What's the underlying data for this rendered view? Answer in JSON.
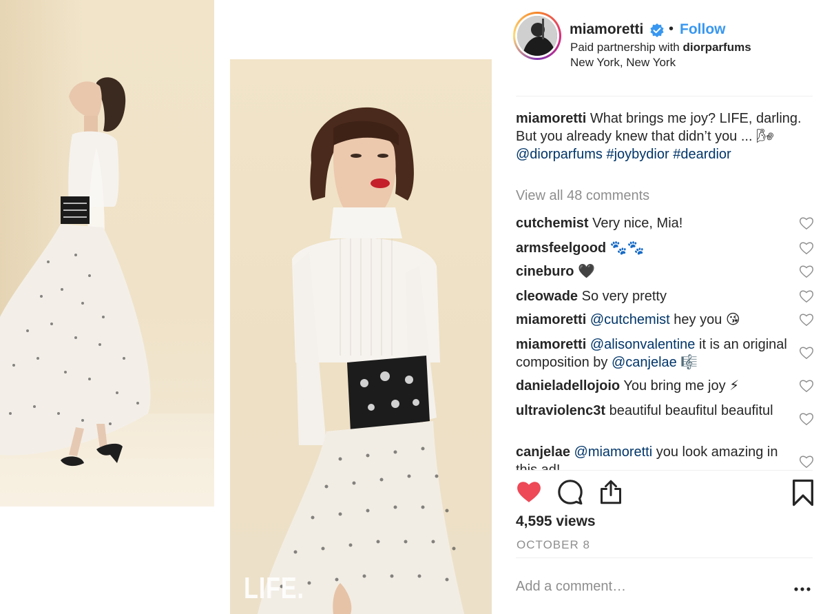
{
  "media": {
    "overlay_text": "LIFE."
  },
  "header": {
    "username": "miamoretti",
    "separator": "•",
    "follow_label": "Follow",
    "partnership_prefix": "Paid partnership with ",
    "partner": "diorparfums",
    "location": "New York, New York"
  },
  "caption": {
    "username": "miamoretti",
    "text": "What brings me joy? LIFE, darling. But you already knew that didn’t you ... ",
    "emoji": "🌬",
    "mention": "@diorparfums",
    "hashtag1": "#joybydior",
    "hashtag2": "#deardior"
  },
  "view_all_comments": "View all 48 comments",
  "comments": [
    {
      "user": "cutchemist",
      "text": "Very nice, Mia!"
    },
    {
      "user": "armsfeelgood",
      "text": "🐾🐾"
    },
    {
      "user": "cineburo",
      "text": "🖤"
    },
    {
      "user": "cleowade",
      "text": "So very pretty"
    },
    {
      "user": "miamoretti",
      "mention": "@cutchemist",
      "text": "hey you 😘"
    },
    {
      "user": "miamoretti",
      "mention": "@alisonvalentine",
      "text": "it is an original composition by",
      "mention2": "@canjelae",
      "text2": "🎼"
    },
    {
      "user": "danieladellojoio",
      "text": "You bring me joy ⚡"
    },
    {
      "user": "ultraviolenc3t",
      "text": "beautiful beaufitul beaufitul"
    },
    {
      "user": "canjelae",
      "mention": "@miamoretti",
      "text": "you look amazing in this ad!"
    }
  ],
  "stats": {
    "views": "4,595 views",
    "date": "OCTOBER 8"
  },
  "add_comment": {
    "placeholder": "Add a comment…"
  },
  "colors": {
    "link_blue": "#3897f0",
    "mention_blue": "#003569",
    "like_red": "#ed4956",
    "muted_gray": "#8e8e8e"
  }
}
